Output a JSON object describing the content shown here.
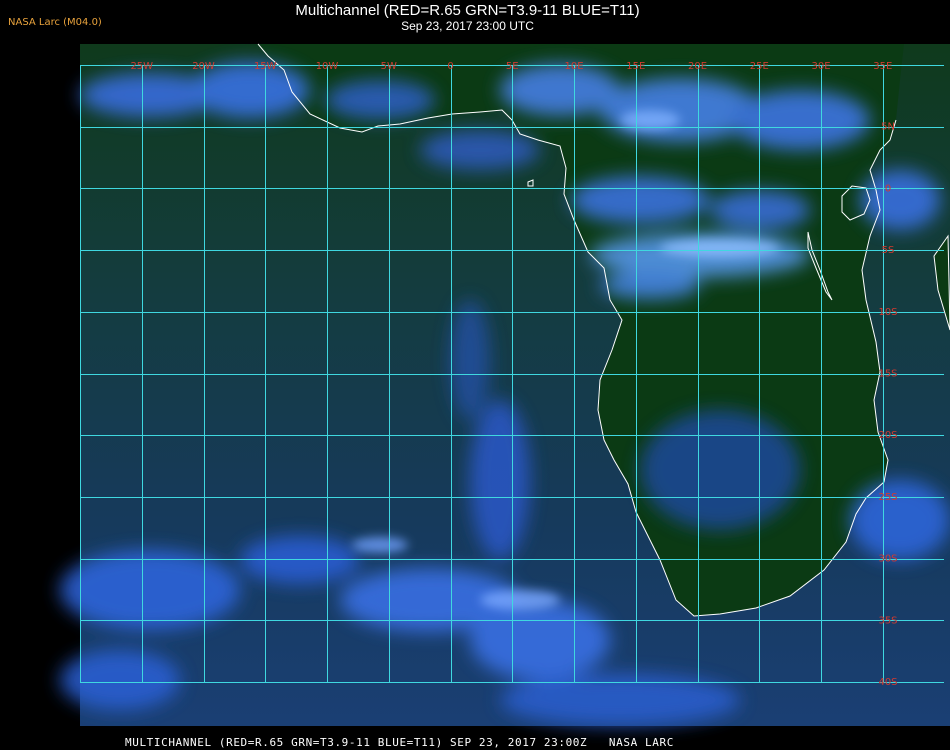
{
  "header": {
    "credit": "NASA Larc (M04.0)",
    "title": "Multichannel (RED=R.65 GRN=T3.9-11 BLUE=T11)",
    "subtitle": "Sep 23, 2017 23:00 UTC"
  },
  "footer": {
    "text": "MULTICHANNEL (RED=R.65 GRN=T3.9-11 BLUE=T11) SEP 23, 2017 23:00Z   NASA LARC"
  },
  "map": {
    "longitude_labels": [
      "25W",
      "20W",
      "15W",
      "10W",
      "5W",
      "0",
      "5E",
      "10E",
      "15E",
      "20E",
      "25E",
      "30E",
      "35E"
    ],
    "latitude_labels": [
      "5N",
      "0",
      "5S",
      "10S",
      "15S",
      "20S",
      "25S",
      "30S",
      "35S",
      "40S"
    ],
    "colors": {
      "grid": "#3fd8e0",
      "labels": "#d23a30",
      "coast": "#ffffff",
      "land": "#0c3a12",
      "ocean": "#173a55",
      "cloud": "#3a78f0"
    }
  }
}
